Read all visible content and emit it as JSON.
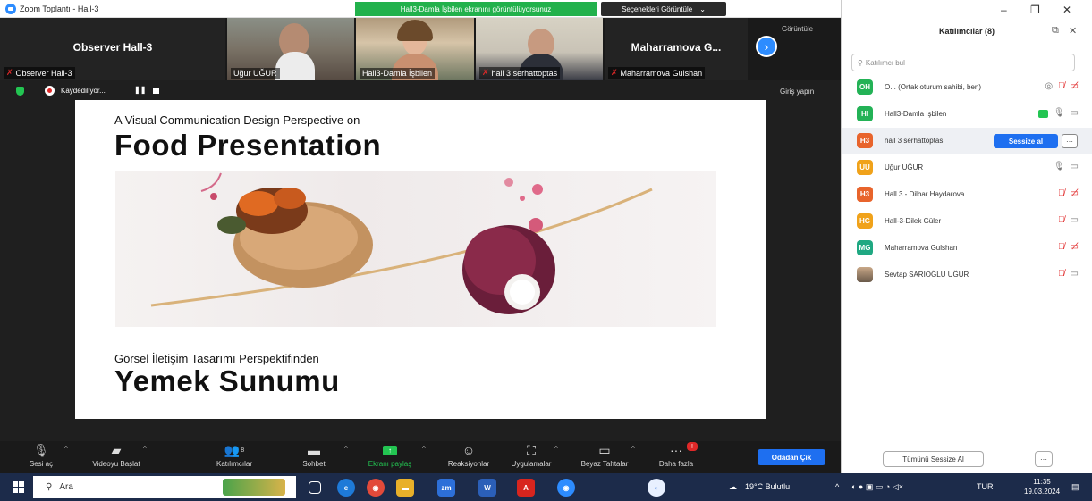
{
  "window": {
    "title": "Zoom Toplantı - Hall-3",
    "share_banner": "Hall3-Damla İşbilen ekranını görüntülüyorsunuz",
    "view_options": "Seçenekleri Görüntüle",
    "minimize": "–",
    "restore": "❐",
    "close": "✕"
  },
  "video_strip": {
    "tiles": [
      {
        "big_name": "Observer Hall-3",
        "caption": "Observer Hall-3",
        "muted": true
      },
      {
        "big_name": "",
        "caption": "Uğur UĞUR",
        "muted": false
      },
      {
        "big_name": "",
        "caption": "Hall3-Damla İşbilen",
        "muted": false
      },
      {
        "big_name": "",
        "caption": "hall 3 serhattoptas",
        "muted": true
      },
      {
        "big_name": "Maharramova G...",
        "caption": "Maharramova Gulshan",
        "muted": true
      }
    ],
    "view_label": "Görüntüle"
  },
  "record_bar": {
    "status": "Kaydediliyor...",
    "pause": "❚❚",
    "sign_in": "Giriş yapın"
  },
  "slide": {
    "subtitle_en": "A Visual Communication Design Perspective on",
    "title_en": "Food Presentation",
    "subtitle_tr": "Görsel İletişim Tasarımı Perspektifinden",
    "title_tr": "Yemek Sunumu"
  },
  "toolbar": {
    "buttons": [
      {
        "label": "Sesi aç",
        "icon": "mic-off-icon"
      },
      {
        "label": "Videoyu Başlat",
        "icon": "video-off-icon"
      },
      {
        "label": "Katılımcılar",
        "icon": "participants-icon",
        "count": "8"
      },
      {
        "label": "Sohbet",
        "icon": "chat-icon"
      },
      {
        "label": "Ekranı paylaş",
        "icon": "share-screen-icon"
      },
      {
        "label": "Reaksiyonlar",
        "icon": "reactions-icon"
      },
      {
        "label": "Uygulamalar",
        "icon": "apps-icon"
      },
      {
        "label": "Beyaz Tahtalar",
        "icon": "whiteboard-icon"
      },
      {
        "label": "Daha fazla",
        "icon": "more-icon"
      }
    ],
    "leave": "Odadan Çık",
    "share_color": "#23c552",
    "accent": "#1e6ff0"
  },
  "participants": {
    "title": "Katılımcılar (8)",
    "search_placeholder": "Katılımcı bul",
    "list": [
      {
        "initials": "OH",
        "color": "#23b256",
        "name": "O... (Ortak oturum sahibi, ben)",
        "mic": "off",
        "cam": "off",
        "extra": "◎"
      },
      {
        "initials": "HI",
        "color": "#23b256",
        "name": "Hall3-Damla İşbilen",
        "mic": "on",
        "cam": "on",
        "share": true
      },
      {
        "initials": "H3",
        "color": "#e8642c",
        "name": "hall 3 serhattoptas",
        "mute_btn": "Sessize al",
        "more": "···"
      },
      {
        "initials": "UU",
        "color": "#f0a21a",
        "name": "Uğur UĞUR",
        "mic": "on",
        "cam": "on"
      },
      {
        "initials": "H3",
        "color": "#e8642c",
        "name": "Hall 3 - Dilbar Haydarova",
        "mic": "off",
        "cam": "off"
      },
      {
        "initials": "HG",
        "color": "#f0a21a",
        "name": "Hall-3-Dilek Güler",
        "mic": "off",
        "cam": "on"
      },
      {
        "initials": "MG",
        "color": "#1fa882",
        "name": "Maharramova Gulshan",
        "mic": "off",
        "cam": "off"
      },
      {
        "initials": "",
        "color": "#7a6a5a",
        "name": "Sevtap SARIOĞLU UĞUR",
        "mic": "off",
        "cam": "on",
        "photo": true
      }
    ],
    "mute_all": "Tümünü Sessize Al",
    "more": "···"
  },
  "taskbar": {
    "search": "Ara",
    "weather": "19°C Bulutlu",
    "lang": "TUR",
    "time": "11:35",
    "date": "19.03.2024"
  }
}
